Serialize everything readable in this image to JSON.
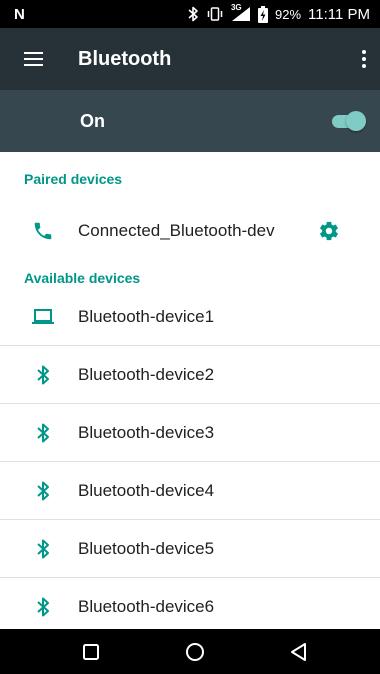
{
  "status_bar": {
    "carrier_logo": "N",
    "icons": [
      "bluetooth-icon",
      "vibrate-icon",
      "signal-icon",
      "battery-charging-icon"
    ],
    "network_type": "3G",
    "battery_percent": "92%",
    "time": "11:11 PM"
  },
  "toolbar": {
    "menu_icon": "hamburger-menu-icon",
    "title": "Bluetooth",
    "overflow_icon": "more-vert-icon"
  },
  "switch_bar": {
    "label": "On",
    "state": "on"
  },
  "paired": {
    "header": "Paired devices",
    "devices": [
      {
        "name": "Connected_Bluetooth-dev",
        "icon": "phone-icon",
        "settings_icon": "gear-icon"
      }
    ]
  },
  "available": {
    "header": "Available devices",
    "devices": [
      {
        "name": "Bluetooth-device1",
        "icon": "laptop-icon"
      },
      {
        "name": "Bluetooth-device2",
        "icon": "bluetooth-icon"
      },
      {
        "name": "Bluetooth-device3",
        "icon": "bluetooth-icon"
      },
      {
        "name": "Bluetooth-device4",
        "icon": "bluetooth-icon"
      },
      {
        "name": "Bluetooth-device5",
        "icon": "bluetooth-icon"
      },
      {
        "name": "Bluetooth-device6",
        "icon": "bluetooth-icon"
      }
    ]
  },
  "nav_bar": {
    "buttons": [
      "recents-square-icon",
      "home-circle-icon",
      "back-triangle-icon"
    ]
  },
  "colors": {
    "toolbar_bg": "#263238",
    "switchbar_bg": "#37474f",
    "accent": "#009688",
    "toggle": "#80cbc4",
    "status_bar_bg": "#000000"
  }
}
